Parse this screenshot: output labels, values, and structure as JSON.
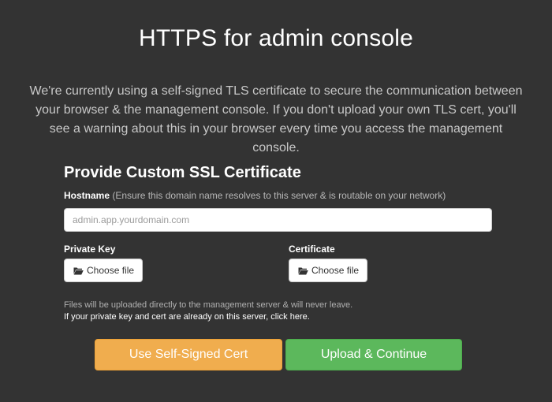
{
  "header": {
    "title": "HTTPS for admin console",
    "intro": "We're currently using a self-signed TLS certificate to secure the communication between your browser & the management console. If you don't upload your own TLS cert, you'll see a warning about this in your browser every time you access the management console."
  },
  "form": {
    "section_title": "Provide Custom SSL Certificate",
    "hostname": {
      "label": "Hostname",
      "hint": "(Ensure this domain name resolves to this server & is routable on your network)",
      "value": "",
      "placeholder": "admin.app.yourdomain.com"
    },
    "private_key": {
      "label": "Private Key",
      "button_label": "Choose file",
      "icon": "folder-open-icon"
    },
    "certificate": {
      "label": "Certificate",
      "button_label": "Choose file",
      "icon": "folder-open-icon"
    },
    "upload_note": "Files will be uploaded directly to the management server & will never leave.",
    "server_files_link": "If your private key and cert are already on this server, click here."
  },
  "actions": {
    "self_signed_label": "Use Self-Signed Cert",
    "upload_label": "Upload & Continue"
  },
  "colors": {
    "background": "#333333",
    "warning_button": "#f0ad4e",
    "success_button": "#5cb85c"
  }
}
